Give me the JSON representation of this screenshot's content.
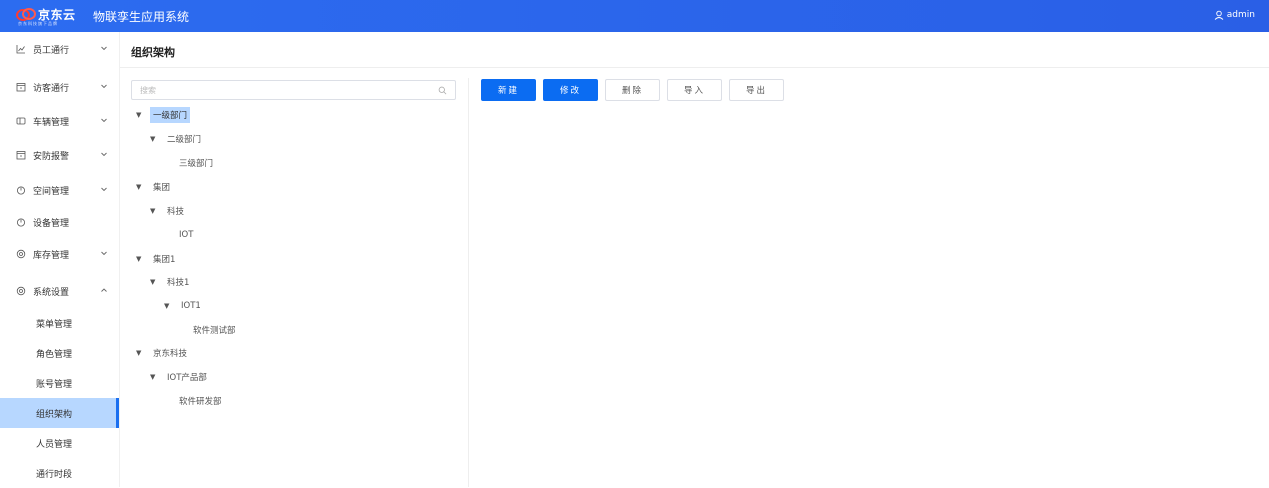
{
  "header": {
    "logo_text": "京东云",
    "logo_sub": "京东科技旗下品牌",
    "app_title": "物联孪生应用系统",
    "user": "admin"
  },
  "sidebar": {
    "items": [
      {
        "label": "员工通行",
        "icon": "chart-line-icon",
        "expanded": false
      },
      {
        "label": "访客通行",
        "icon": "calendar-icon",
        "expanded": false
      },
      {
        "label": "车辆管理",
        "icon": "tag-icon",
        "expanded": false
      },
      {
        "label": "安防报警",
        "icon": "calendar-icon",
        "expanded": false
      },
      {
        "label": "空间管理",
        "icon": "power-icon",
        "expanded": false
      },
      {
        "label": "设备管理",
        "icon": "power-icon",
        "expanded": false
      },
      {
        "label": "库存管理",
        "icon": "settings-icon",
        "expanded": false
      },
      {
        "label": "系统设置",
        "icon": "settings-icon",
        "expanded": true
      }
    ],
    "subitems": [
      {
        "label": "菜单管理",
        "active": false
      },
      {
        "label": "角色管理",
        "active": false
      },
      {
        "label": "账号管理",
        "active": false
      },
      {
        "label": "组织架构",
        "active": true
      },
      {
        "label": "人员管理",
        "active": false
      },
      {
        "label": "通行时段",
        "active": false
      }
    ]
  },
  "main": {
    "title": "组织架构",
    "search_placeholder": "搜索",
    "buttons": {
      "new": "新建",
      "edit": "修改",
      "delete": "删除",
      "import": "导入",
      "export": "导出"
    },
    "tree": [
      {
        "label": "一级部门",
        "level": 0,
        "expanded": true,
        "selected": true
      },
      {
        "label": "二级部门",
        "level": 1,
        "expanded": true,
        "selected": false
      },
      {
        "label": "三级部门",
        "level": 2,
        "leaf": true,
        "selected": false
      },
      {
        "label": "集团",
        "level": 0,
        "expanded": true,
        "selected": false
      },
      {
        "label": "科技",
        "level": 1,
        "expanded": true,
        "selected": false
      },
      {
        "label": "IOT",
        "level": 2,
        "leaf": true,
        "selected": false
      },
      {
        "label": "集团1",
        "level": 0,
        "expanded": true,
        "selected": false
      },
      {
        "label": "科技1",
        "level": 1,
        "expanded": true,
        "selected": false
      },
      {
        "label": "IOT1",
        "level": 2,
        "expanded": true,
        "selected": false
      },
      {
        "label": "软件测试部",
        "level": 3,
        "leaf": true,
        "selected": false
      },
      {
        "label": "京东科技",
        "level": 0,
        "expanded": true,
        "selected": false
      },
      {
        "label": "IOT产品部",
        "level": 1,
        "expanded": true,
        "selected": false
      },
      {
        "label": "软件研发部",
        "level": 2,
        "leaf": true,
        "selected": false
      }
    ]
  },
  "colors": {
    "header": "#2c6cf0",
    "primary": "#0b6cf2",
    "selected_bg": "#b7d7ff",
    "active_bar": "#1a6ff0"
  }
}
